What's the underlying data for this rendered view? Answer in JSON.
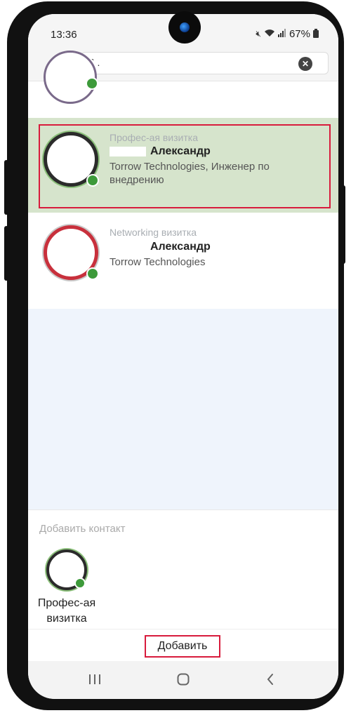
{
  "status_bar": {
    "time": "13:36",
    "battery": "67%"
  },
  "search": {
    "value": "`        ."
  },
  "cards": [
    {
      "type": "Профес-ая визитка",
      "name": "Александр",
      "company": "Torrow Technologies, Инженер по внедрению",
      "selected": true
    },
    {
      "type": "Networking визитка",
      "name": "Александр",
      "company": "Torrow Technologies",
      "selected": false
    }
  ],
  "add_contact": {
    "title": "Добавить контакт",
    "card_label": "Профес-ая визитка"
  },
  "actions": {
    "add_label": "Добавить"
  },
  "colors": {
    "selected_bg": "#d6e4cc",
    "highlight_outline": "#d81b3c",
    "online_dot": "#3d9a3a",
    "list_bg": "#eff4fc"
  },
  "icons": {
    "back": "chevron-left",
    "clear": "close-circle",
    "nav": [
      "recents",
      "home",
      "back"
    ]
  }
}
